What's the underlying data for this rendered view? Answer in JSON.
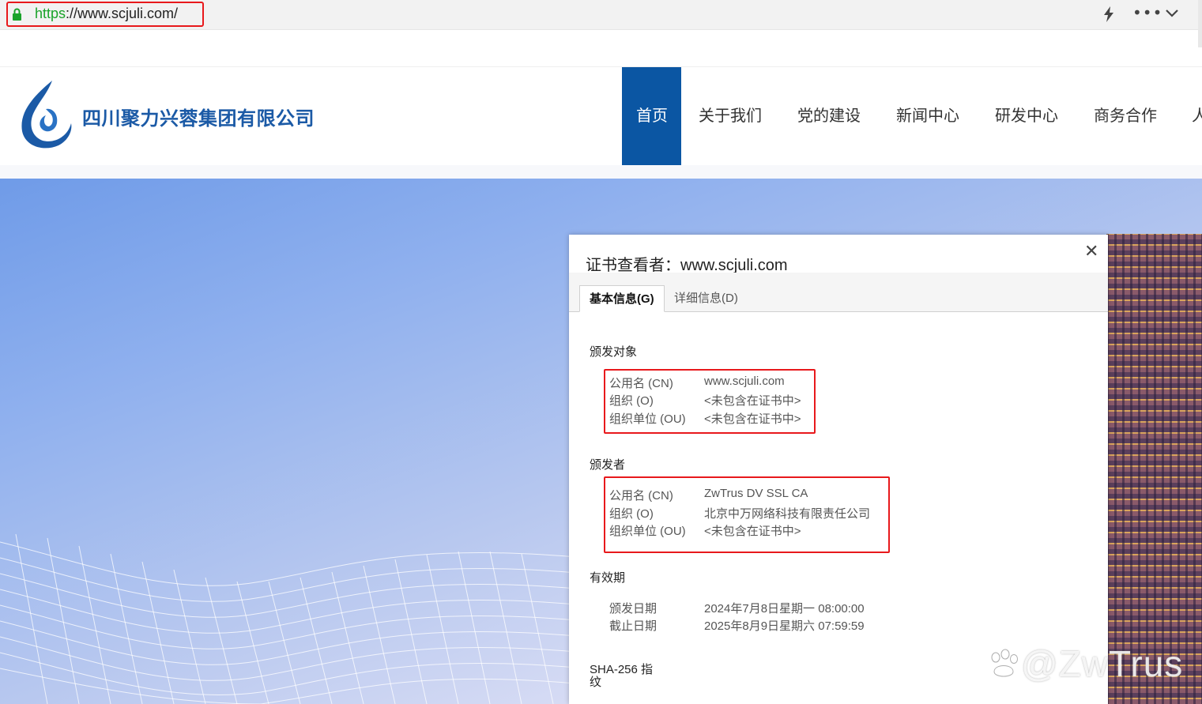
{
  "browser": {
    "url_scheme": "https",
    "url_rest": "://www.scjuli.com/",
    "icons": [
      "lock-icon",
      "lightning-icon",
      "more-icon",
      "chevron-down-icon"
    ]
  },
  "site": {
    "company_name": "四川聚力兴蓉集团有限公司",
    "nav": [
      {
        "label": "首页",
        "active": true
      },
      {
        "label": "关于我们"
      },
      {
        "label": "党的建设"
      },
      {
        "label": "新闻中心"
      },
      {
        "label": "研发中心"
      },
      {
        "label": "商务合作"
      },
      {
        "label": "人"
      }
    ],
    "brand_color": "#0b56a3"
  },
  "certificate": {
    "title": "证书查看者：www.scjuli.com",
    "tabs": [
      {
        "label": "基本信息(G)",
        "active": true
      },
      {
        "label": "详细信息(D)"
      }
    ],
    "issued_to": {
      "heading": "颁发对象",
      "rows": [
        {
          "label": "公用名 (CN)",
          "value": "www.scjuli.com"
        },
        {
          "label": "组织 (O)",
          "value": "<未包含在证书中>"
        },
        {
          "label": "组织单位 (OU)",
          "value": "<未包含在证书中>"
        }
      ]
    },
    "issued_by": {
      "heading": "颁发者",
      "rows": [
        {
          "label": "公用名 (CN)",
          "value": "ZwTrus DV SSL CA"
        },
        {
          "label": "组织 (O)",
          "value": "北京中万网络科技有限责任公司"
        },
        {
          "label": "组织单位 (OU)",
          "value": "<未包含在证书中>"
        }
      ]
    },
    "validity": {
      "heading": "有效期",
      "rows": [
        {
          "label": "颁发日期",
          "value": "2024年7月8日星期一 08:00:00"
        },
        {
          "label": "截止日期",
          "value": "2025年8月9日星期六 07:59:59"
        }
      ]
    },
    "fingerprint_heading_line1": "SHA-256 指",
    "fingerprint_heading_line2": "纹",
    "highlight_color": "#e8191c"
  },
  "watermark": "@ZwTrus"
}
